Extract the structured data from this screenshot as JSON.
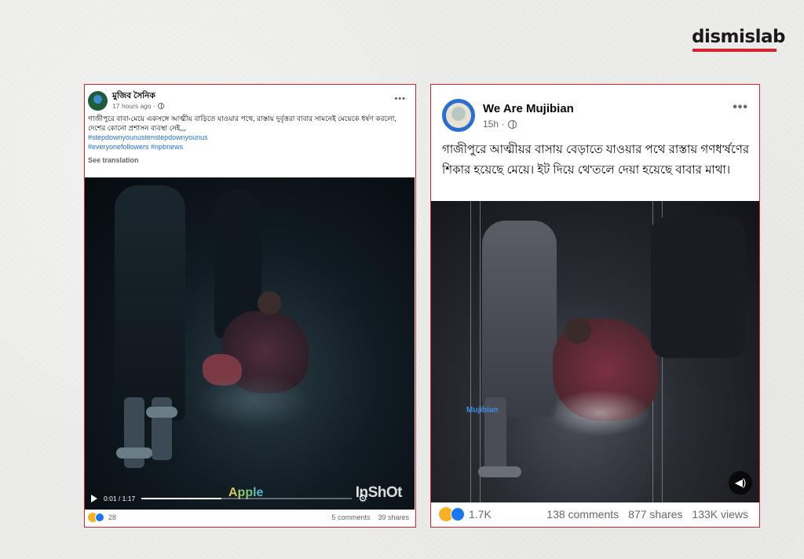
{
  "brand": {
    "logo_text": "dismislab",
    "accent": "#d9232e"
  },
  "left_post": {
    "author": "মুজিব সৈনিক",
    "time": "17 hours ago ·",
    "text": "গাজীপুরে বাবা-মেয়ে একসঙ্গে আত্মীয় বাড়িতে যাওয়ার পথে, রাস্তায় দুর্বৃত্তরা বাবার সামনেই মেয়েকে ধর্ষণ করলো, দেশের কোনো প্রশাসন ব্যবস্থা নেই,,,",
    "hashtags": [
      "#stepdownyounustenstepdownyounus",
      "#everyonefollowers #npbnews"
    ],
    "see_translation": "See translation",
    "video": {
      "time_display": "0:01 / 1:17",
      "progress": 0.38
    },
    "watermarks": {
      "apple": "Apple",
      "inshot": "InShOt"
    },
    "reactions_count": "28",
    "comments": "5 comments",
    "shares": "39 shares",
    "icons": [
      "globe-icon",
      "more-icon",
      "play-icon",
      "gear-icon",
      "sad-reaction-icon",
      "like-reaction-icon"
    ]
  },
  "right_post": {
    "author": "We Are Mujibian",
    "time": "15h ·",
    "text": "গাজীপুরে আত্মীয়র বাসায় বেড়াতে যাওয়ার পথে রাস্তায় গণধ'র্ষণের শিকার হয়েছে মেয়ে। ইট দিয়ে থে'তলে দেয়া হয়েছে বাবার মাথা।",
    "watermark": "Mujibian",
    "reactions_count": "1.7K",
    "comments": "138 comments",
    "shares": "877 shares",
    "views": "133K views",
    "icons": [
      "globe-icon",
      "more-icon",
      "sound-icon",
      "sad-reaction-icon",
      "like-reaction-icon"
    ]
  }
}
